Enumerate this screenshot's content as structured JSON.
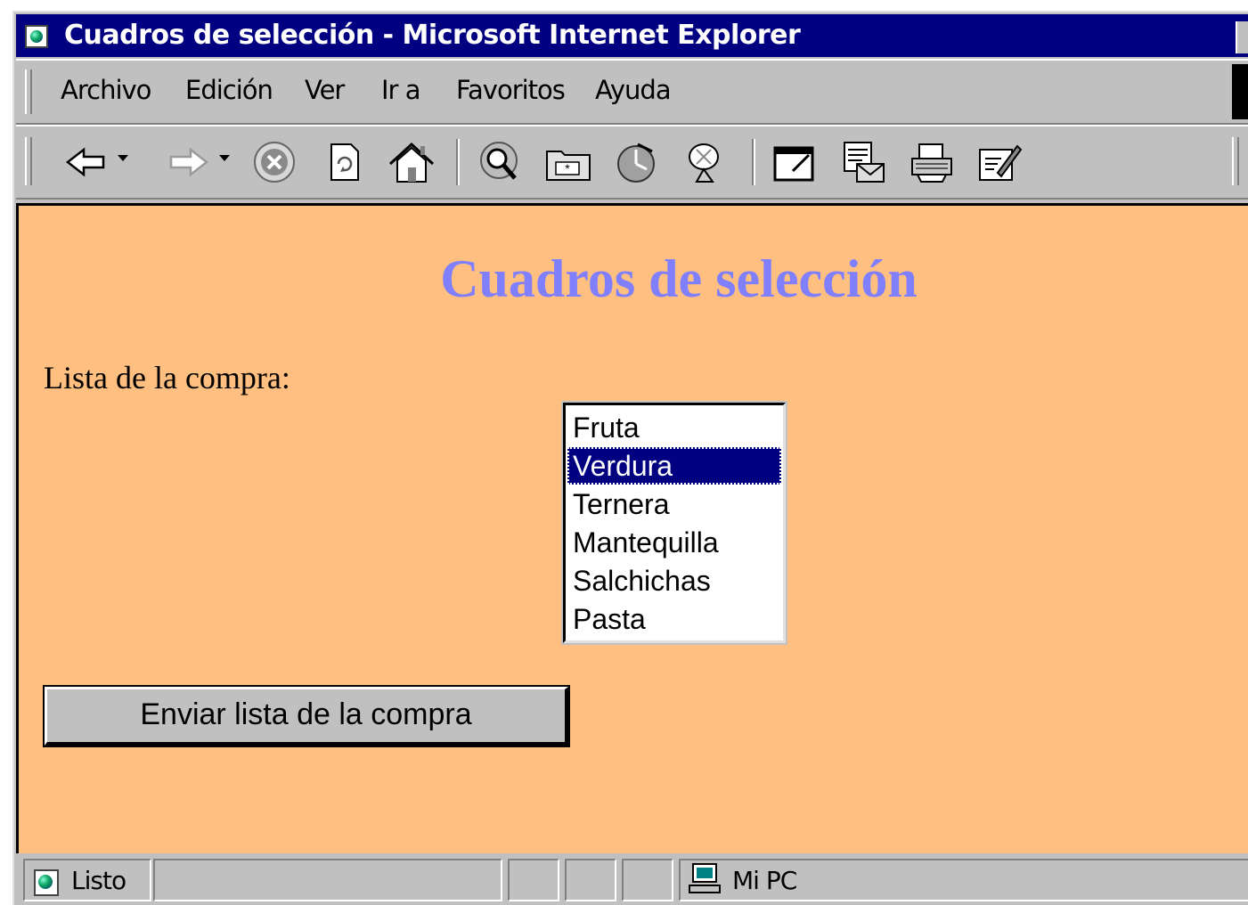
{
  "window": {
    "title": "Cuadros de selección - Microsoft Internet Explorer"
  },
  "menu": {
    "items": [
      "Archivo",
      "Edición",
      "Ver",
      "Ir a",
      "Favoritos",
      "Ayuda"
    ]
  },
  "toolbar": {
    "buttons": [
      "back-icon",
      "forward-icon",
      "stop-icon",
      "refresh-icon",
      "home-icon",
      "search-icon",
      "favorites-icon",
      "history-icon",
      "channels-icon",
      "fullscreen-icon",
      "mail-icon",
      "print-icon",
      "edit-icon"
    ]
  },
  "page": {
    "background": "#ffbf80",
    "heading": "Cuadros de selección",
    "heading_color": "#8080ff",
    "list_label": "Lista de la compra:",
    "listbox": {
      "options": [
        "Fruta",
        "Verdura",
        "Ternera",
        "Mantequilla",
        "Salchichas",
        "Pasta"
      ],
      "selected": "Verdura"
    },
    "submit_label": "Enviar lista de la compra"
  },
  "status": {
    "text": "Listo",
    "zone": "Mi PC"
  },
  "colors": {
    "titlebar": "#000080",
    "chrome": "#c0c0c0",
    "selection": "#000080"
  }
}
